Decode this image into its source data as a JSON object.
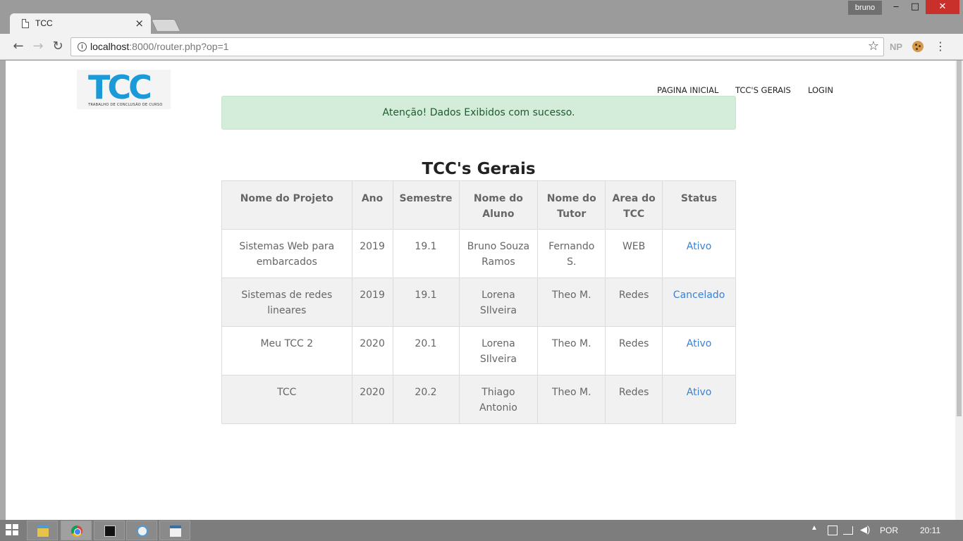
{
  "browser": {
    "tab_title": "TCC",
    "tab_close": "×",
    "profile": "bruno",
    "window_min": "‒",
    "window_max": "□",
    "window_close": "✕",
    "url_host": "localhost",
    "url_path": ":8000/router.php?op=1",
    "ext_np": "NP"
  },
  "site": {
    "logo_text": "TCC",
    "logo_sub": "TRABALHO DE CONCLUSÃO DE CURSO",
    "nav": [
      {
        "label": "PAGINA INICIAL"
      },
      {
        "label": "TCC'S GERAIS"
      },
      {
        "label": "LOGIN"
      }
    ],
    "alert": {
      "strong": "Atenção!",
      "message": " Dados Exibidos com sucesso."
    },
    "title": "TCC's Gerais"
  },
  "table": {
    "headers": [
      "Nome do Projeto",
      "Ano",
      "Semestre",
      "Nome do Aluno",
      "Nome do Tutor",
      "Area do TCC",
      "Status"
    ],
    "rows": [
      {
        "projeto": "Sistemas Web para embarcados",
        "ano": "2019",
        "semestre": "19.1",
        "aluno": "Bruno Souza Ramos",
        "tutor": "Fernando S.",
        "area": "WEB",
        "status": "Ativo"
      },
      {
        "projeto": "Sistemas de redes lineares",
        "ano": "2019",
        "semestre": "19.1",
        "aluno": "Lorena SIlveira",
        "tutor": "Theo M.",
        "area": "Redes",
        "status": "Cancelado"
      },
      {
        "projeto": "Meu TCC 2",
        "ano": "2020",
        "semestre": "20.1",
        "aluno": "Lorena SIlveira",
        "tutor": "Theo M.",
        "area": "Redes",
        "status": "Ativo"
      },
      {
        "projeto": "TCC",
        "ano": "2020",
        "semestre": "20.2",
        "aluno": "Thiago Antonio",
        "tutor": "Theo M.",
        "area": "Redes",
        "status": "Ativo"
      }
    ]
  },
  "taskbar": {
    "language": "POR",
    "time": "20:11"
  },
  "colors": {
    "accent_blue": "#1a9ad9",
    "link_blue": "#3a80d6",
    "alert_bg": "#d4eddb",
    "alert_text": "#1e5a2e",
    "close_red": "#c9302c"
  }
}
